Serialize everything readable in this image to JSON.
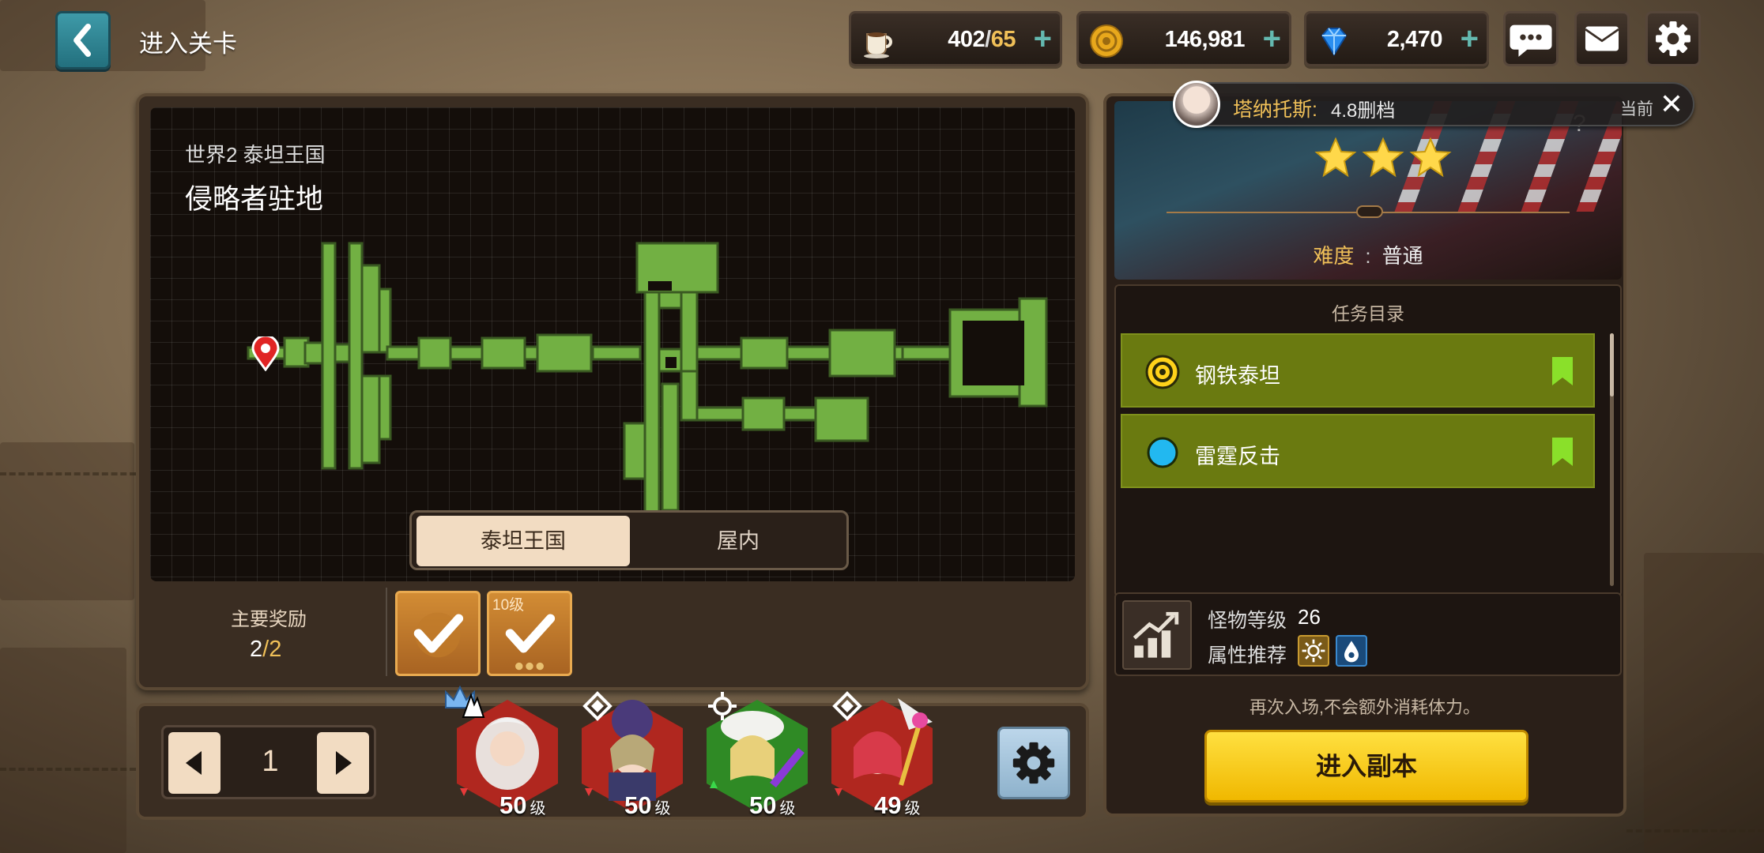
{
  "header": {
    "title": "进入关卡",
    "stamina": {
      "current": "402",
      "max": "65"
    },
    "gold": "146,981",
    "gems": "2,470",
    "plus_symbol": "+"
  },
  "map": {
    "world": "世界2  泰坦王国",
    "stage_name": "侵略者驻地",
    "tabs": [
      {
        "label": "泰坦王国",
        "active": true
      },
      {
        "label": "屋内",
        "active": false
      }
    ]
  },
  "rewards": {
    "label": "主要奖励",
    "count": "2",
    "total": "2",
    "items": [
      {
        "level": "",
        "claimed": true
      },
      {
        "level": "10级",
        "claimed": true
      }
    ]
  },
  "team": {
    "page": "1",
    "level_unit": "级",
    "heroes": [
      {
        "level": "50",
        "color": "#b0271f",
        "class_icon": "warrior-class-icon"
      },
      {
        "level": "50",
        "color": "#b0271f",
        "class_icon": "ranged-class-icon"
      },
      {
        "level": "50",
        "color": "#2f8a25",
        "class_icon": "support-class-icon"
      },
      {
        "level": "49",
        "color": "#b0271f",
        "class_icon": "ranged-class-icon"
      }
    ]
  },
  "notice": {
    "name": "塔纳托斯:",
    "message": "4.8删档",
    "current": "当前",
    "close": "✕"
  },
  "stage_info": {
    "stars": 3,
    "difficulty_label": "难度",
    "difficulty_sep": ":",
    "difficulty_value": "普通",
    "help": "?"
  },
  "missions": {
    "title": "任务目录",
    "items": [
      {
        "name": "钢铁泰坦",
        "icon": "target-ring-icon"
      },
      {
        "name": "雷霆反击",
        "icon": "blue-dot-icon"
      }
    ]
  },
  "monster": {
    "level_label": "怪物等级",
    "level_value": "26",
    "element_label": "属性推荐",
    "elements": [
      "light-element-icon",
      "water-element-icon"
    ]
  },
  "reenter_note": "再次入场,不会额外消耗体力。",
  "enter_button": "进入副本",
  "colors": {
    "accent_yellow": "#f0c058",
    "mission_green": "#6a7a10",
    "map_green": "#72b043",
    "enter_yellow": "#ffd21a"
  }
}
